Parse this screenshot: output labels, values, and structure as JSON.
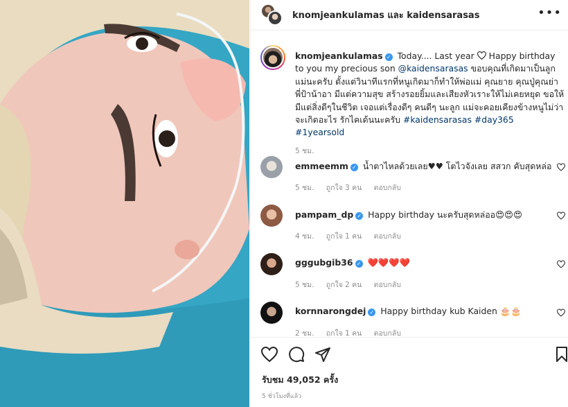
{
  "header": {
    "title": "knomjeankulamas และ kaidensarasas",
    "more_icon": "more-horizontal-icon"
  },
  "caption": {
    "username": "knomjeankulamas",
    "text_a": "Today.... Last year",
    "text_b": "Happy birthday to you my precious son",
    "mention": "@kaidensarasas",
    "text_c": "ขอบคุณที่เกิดมาเป็นลูกแม่นะครับ ตั้งแต่วินาทีแรกที่หนูเกิดมาก็ทำให้พ่อแม่ คุณยาย คุณปู่คุณย่า พี่ป้าน้าอา มีแต่ความสุข สร้างรอยยิ้มและเสียงหัวเราะให้ไม่เคยหยุด ขอให้มีแต่สิ่งดีๆในชีวิต เจอแต่เรื่องดีๆ คนดีๆ นะลูก แม่จะคอยเคียงข้างหนูไม่ว่าจะเกิดอะไร รักไคเด้นนะครับ",
    "hashtags": [
      "#kaidensarasas",
      "#day365",
      "#1yearsold"
    ],
    "time": "5 ชม."
  },
  "comments": [
    {
      "username": "emmeemm",
      "text": "น้ำตาไหลด้วยเลย♥♥ โตไวจังเลย สสวก คับสุดหล่อ",
      "time": "5 ชม.",
      "likes": "ถูกใจ 3 คน",
      "reply": "ตอบกลับ",
      "avatar_color": "#c9ccd2"
    },
    {
      "username": "pampam_dp",
      "text": "Happy birthday นะครับสุดหล่ออ😍😍😍",
      "time": "4 ชม.",
      "likes": "ถูกใจ 1 คน",
      "reply": "ตอบกลับ",
      "avatar_color": "#b87f67"
    },
    {
      "username": "gggubgib36",
      "text": "❤️❤️❤️❤️",
      "time": "5 ชม.",
      "likes": "ถูกใจ 2 คน",
      "reply": "ตอบกลับ",
      "avatar_color": "#3b2a22"
    },
    {
      "username": "kornnarongdej",
      "text": "Happy birthday kub Kaiden 🎂🎂",
      "time": "2 ชม.",
      "likes": "ถูกใจ 1 คน",
      "reply": "ตอบกลับ",
      "avatar_color": "#1e1e1e"
    }
  ],
  "actions": {
    "like_icon": "heart-icon",
    "comment_icon": "comment-icon",
    "share_icon": "send-icon",
    "save_icon": "bookmark-icon",
    "views_label": "รับชม 49,052 ครั้ง",
    "post_time": "5 ชั่วโมงที่แล้ว"
  },
  "colors": {
    "link": "#00376b",
    "verified": "#3897f0",
    "muted": "#8e8e8e",
    "text": "#262626"
  }
}
